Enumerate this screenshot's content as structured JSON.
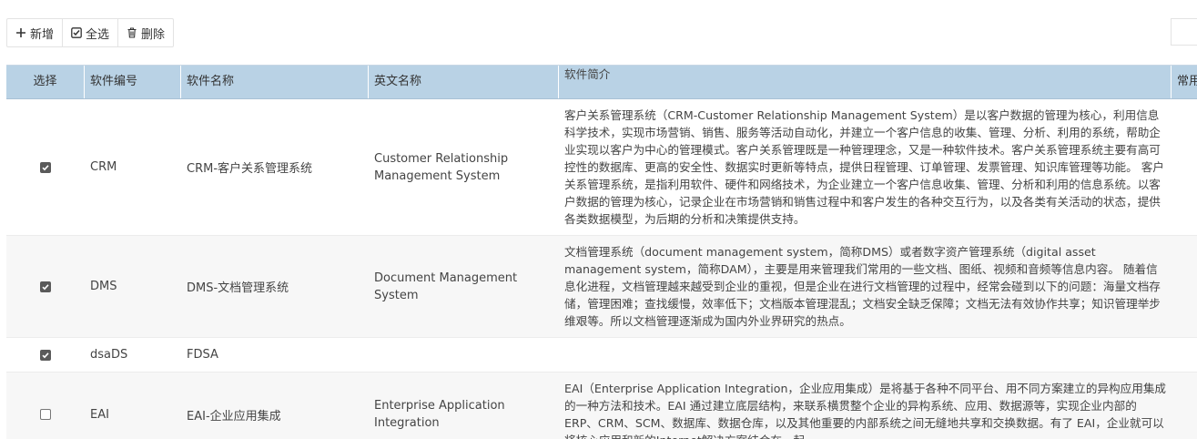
{
  "toolbar": {
    "add_label": "新增",
    "select_all_label": "全选",
    "delete_label": "删除"
  },
  "table": {
    "columns": [
      "选择",
      "软件编号",
      "软件名称",
      "英文名称",
      "软件简介",
      "常用"
    ],
    "rows": [
      {
        "checked": true,
        "id": "CRM",
        "name": "CRM-客户关系管理系统",
        "english_name": "Customer Relationship Management System",
        "description": "客户关系管理系统（CRM-Customer Relationship Management System）是以客户数据的管理为核心，利用信息科学技术，实现市场营销、销售、服务等活动自动化，并建立一个客户信息的收集、管理、分析、利用的系统，帮助企业实现以客户为中心的管理模式。客户关系管理既是一种管理理念，又是一种软件技术。客户关系管理系统主要有高可控性的数据库、更高的安全性、数据实时更新等特点，提供日程管理、订单管理、发票管理、知识库管理等功能。 客户关系管理系统，是指利用软件、硬件和网络技术，为企业建立一个客户信息收集、管理、分析和利用的信息系统。以客户数据的管理为核心，记录企业在市场营销和销售过程中和客户发生的各种交互行为，以及各类有关活动的状态，提供各类数据模型，为后期的分析和决策提供支持。"
      },
      {
        "checked": true,
        "id": "DMS",
        "name": "DMS-文档管理系统",
        "english_name": "Document Management System",
        "description": "文档管理系统（document management system，简称DMS）或者数字资产管理系统（digital asset management system，简称DAM），主要是用来管理我们常用的一些文档、图纸、视频和音频等信息内容。 随着信息化进程，文档管理越来越受到企业的重视，但是企业在进行文档管理的过程中，经常会碰到以下的问题：海量文档存储，管理困难；查找缓慢，效率低下；文档版本管理混乱；文档安全缺乏保障；文档无法有效协作共享；知识管理举步维艰等。所以文档管理逐渐成为国内外业界研究的热点。"
      },
      {
        "checked": true,
        "id": "dsaDS",
        "name": "FDSA",
        "english_name": "",
        "description": ""
      },
      {
        "checked": false,
        "id": "EAI",
        "name": "EAI-企业应用集成",
        "english_name": "Enterprise Application Integration",
        "description": "EAI（Enterprise Application Integration，企业应用集成）是将基于各种不同平台、用不同方案建立的异构应用集成的一种方法和技术。EAI 通过建立底层结构，来联系横贯整个企业的异构系统、应用、数据源等，实现企业内部的ERP、CRM、SCM、数据库、数据仓库，以及其他重要的内部系统之间无缝地共享和交换数据。有了 EAI，企业就可以将核心应用和新的Internet解决方案结合在一起。"
      }
    ]
  }
}
